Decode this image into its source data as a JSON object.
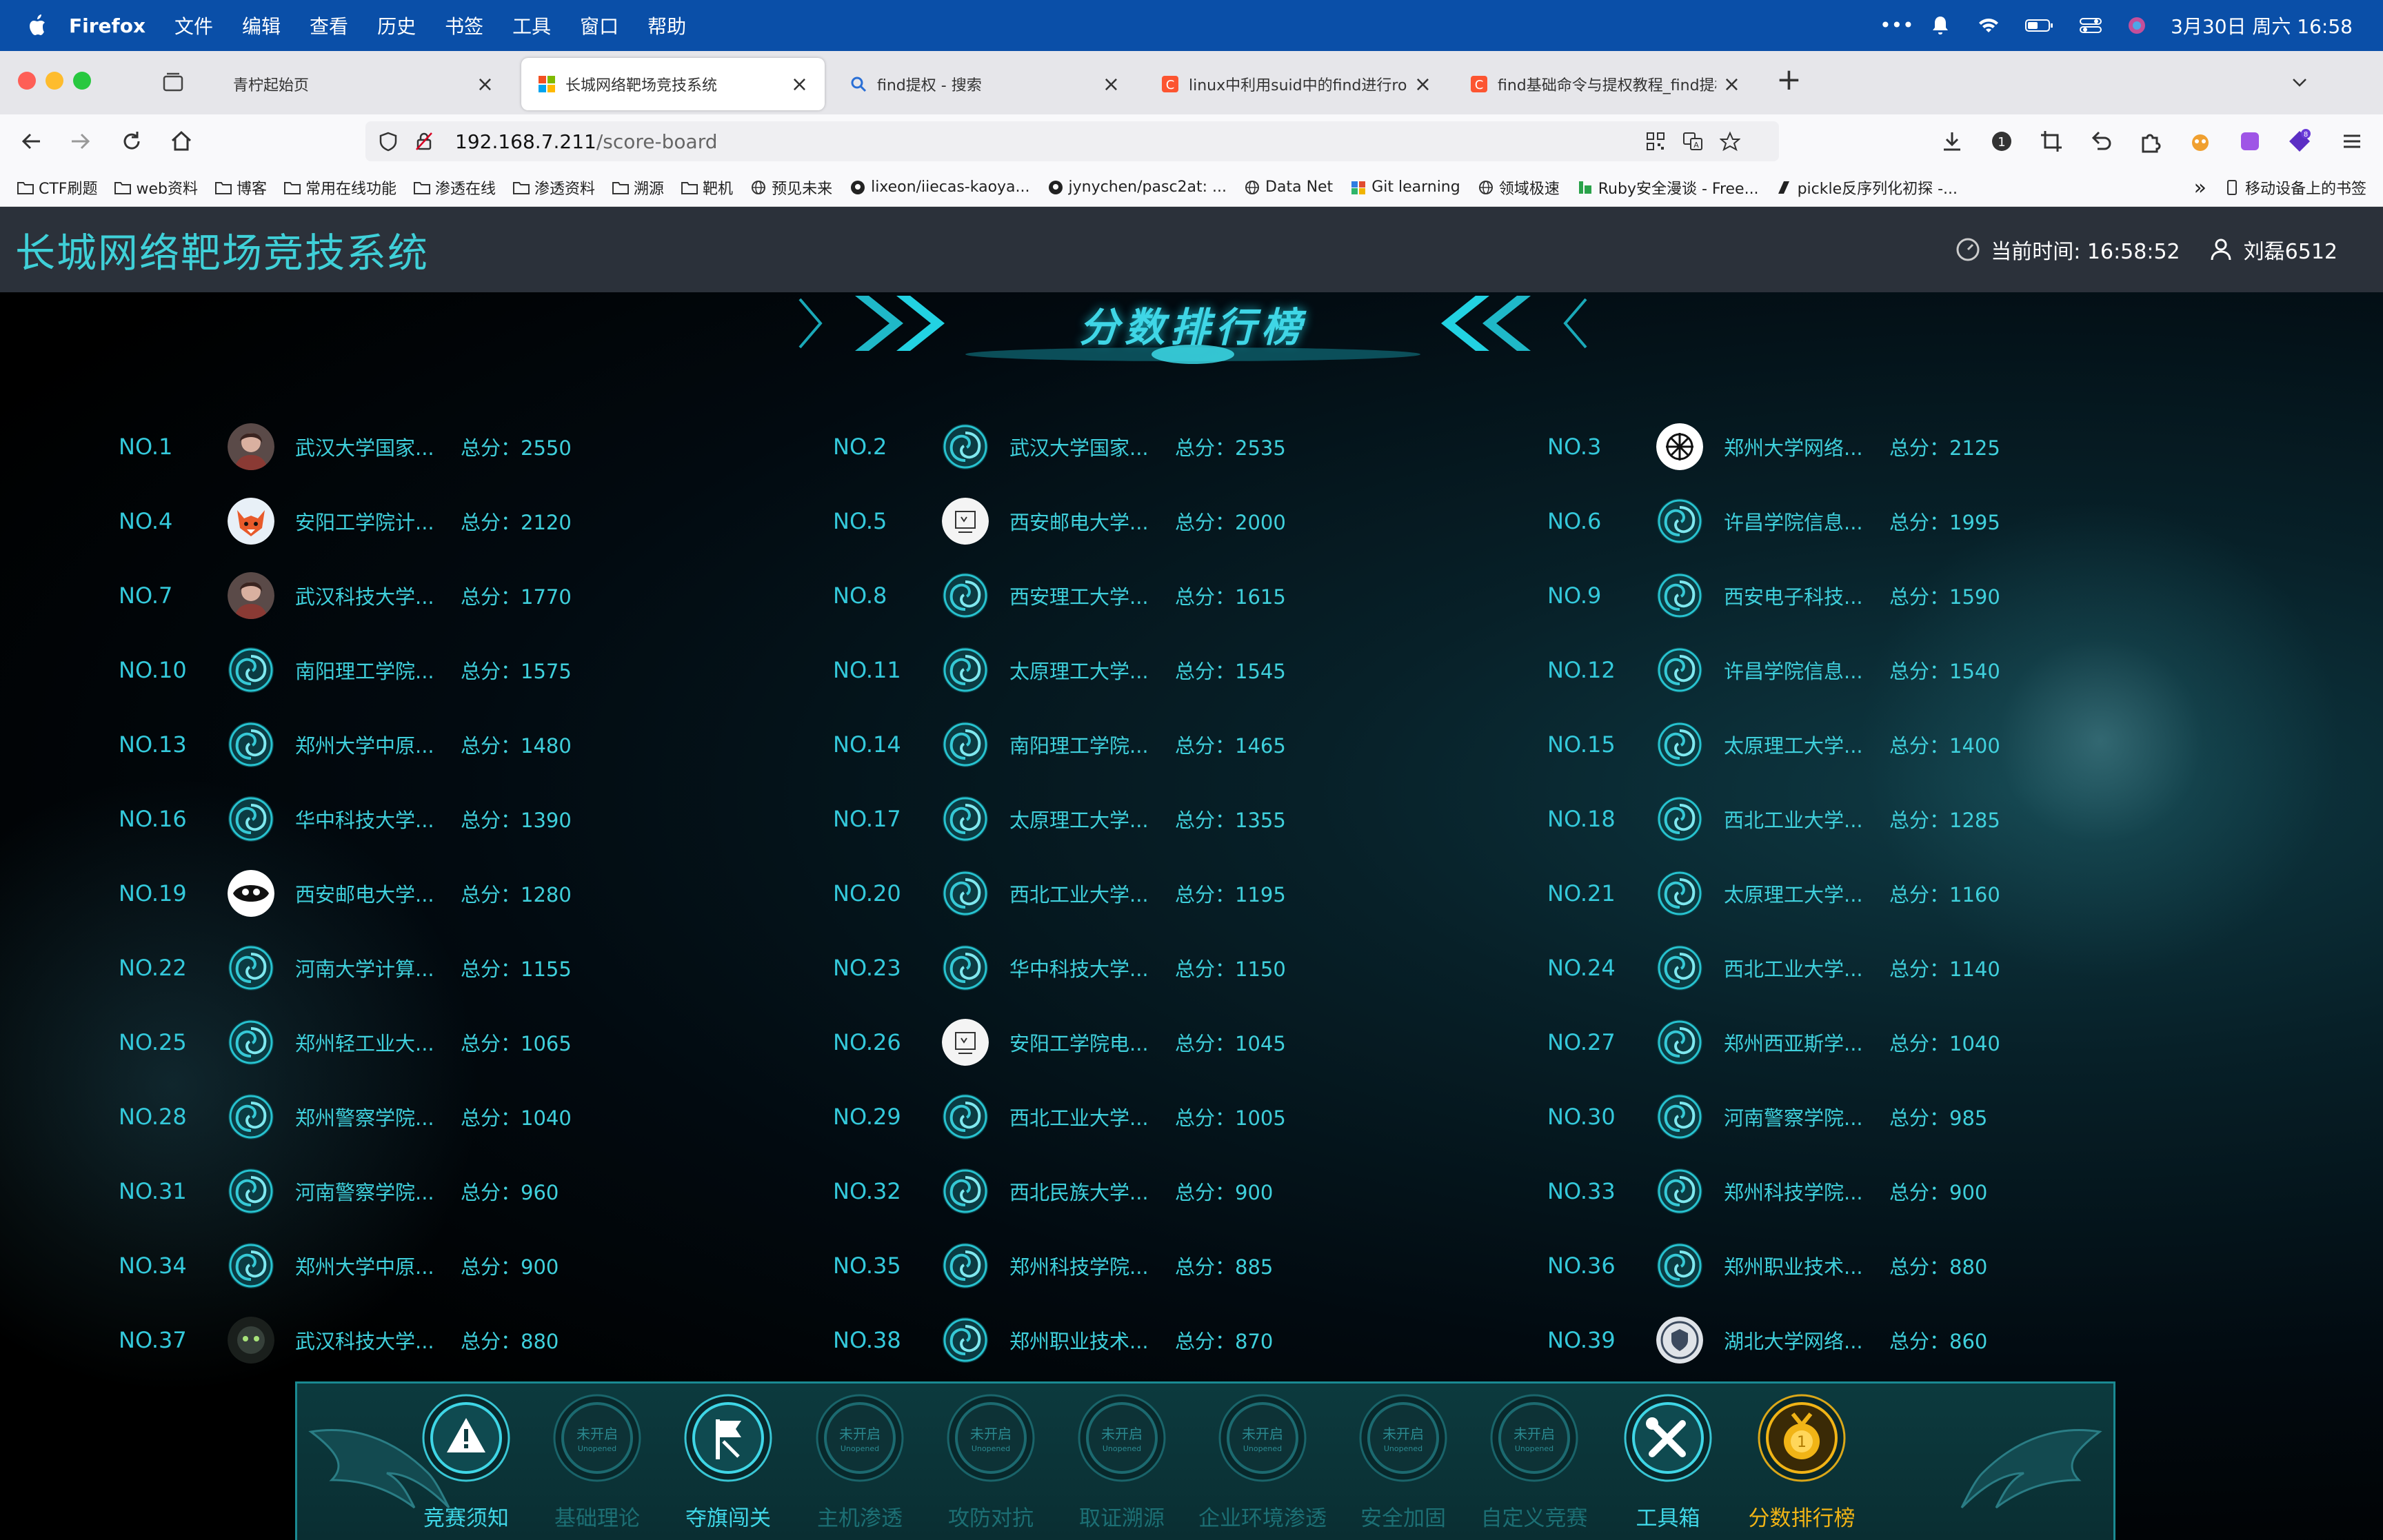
{
  "menubar": {
    "app": "Firefox",
    "menus": [
      "文件",
      "编辑",
      "查看",
      "历史",
      "书签",
      "工具",
      "窗口",
      "帮助"
    ],
    "clock": "3月30日 周六  16:58"
  },
  "tabs": [
    {
      "title": "青柠起始页",
      "active": false
    },
    {
      "title": "长城网络靶场竞技系统",
      "active": true
    },
    {
      "title": "find提权 - 搜索",
      "active": false
    },
    {
      "title": "linux中利用suid中的find进行root",
      "active": false
    },
    {
      "title": "find基础命令与提权教程_find提权",
      "active": false
    }
  ],
  "new_tab": "+",
  "url": {
    "host": "192.168.7.211",
    "path": "/score-board"
  },
  "bookmarks": [
    "CTF刷题",
    "web资料",
    "博客",
    "常用在线功能",
    "渗透在线",
    "渗透资料",
    "溯源",
    "靶机",
    "预见未来",
    "lixeon/iiecas-kaoya...",
    "jynychen/pasc2at: ...",
    "Data Net",
    "Git learning",
    "领域极速",
    "Ruby安全漫谈 - Free...",
    "pickle反序列化初探 -..."
  ],
  "bookmarks_more": "»",
  "mobile_bookmarks": "移动设备上的书签",
  "site": {
    "title": "长城网络靶场竞技系统",
    "time_label": "当前时间: 16:58:52",
    "user": "刘磊6512"
  },
  "board": {
    "title": "分数排行榜",
    "score_prefix": "总分：",
    "entries": [
      {
        "no": "NO.1",
        "name": "武汉大学国家...",
        "score": "2550",
        "avatar": "photo"
      },
      {
        "no": "NO.2",
        "name": "武汉大学国家...",
        "score": "2535",
        "avatar": "swirl"
      },
      {
        "no": "NO.3",
        "name": "郑州大学网络...",
        "score": "2125",
        "avatar": "knot"
      },
      {
        "no": "NO.4",
        "name": "安阳工学院计...",
        "score": "2120",
        "avatar": "fox"
      },
      {
        "no": "NO.5",
        "name": "西安邮电大学...",
        "score": "2000",
        "avatar": "sketch"
      },
      {
        "no": "NO.6",
        "name": "许昌学院信息...",
        "score": "1995",
        "avatar": "swirl"
      },
      {
        "no": "NO.7",
        "name": "武汉科技大学...",
        "score": "1770",
        "avatar": "photo"
      },
      {
        "no": "NO.8",
        "name": "西安理工大学...",
        "score": "1615",
        "avatar": "swirl"
      },
      {
        "no": "NO.9",
        "name": "西安电子科技...",
        "score": "1590",
        "avatar": "swirl"
      },
      {
        "no": "NO.10",
        "name": "南阳理工学院...",
        "score": "1575",
        "avatar": "swirl"
      },
      {
        "no": "NO.11",
        "name": "太原理工大学...",
        "score": "1545",
        "avatar": "swirl"
      },
      {
        "no": "NO.12",
        "name": "许昌学院信息...",
        "score": "1540",
        "avatar": "swirl"
      },
      {
        "no": "NO.13",
        "name": "郑州大学中原...",
        "score": "1480",
        "avatar": "swirl"
      },
      {
        "no": "NO.14",
        "name": "南阳理工学院...",
        "score": "1465",
        "avatar": "swirl"
      },
      {
        "no": "NO.15",
        "name": "太原理工大学...",
        "score": "1400",
        "avatar": "swirl"
      },
      {
        "no": "NO.16",
        "name": "华中科技大学...",
        "score": "1390",
        "avatar": "swirl"
      },
      {
        "no": "NO.17",
        "name": "太原理工大学...",
        "score": "1355",
        "avatar": "swirl"
      },
      {
        "no": "NO.18",
        "name": "西北工业大学...",
        "score": "1285",
        "avatar": "swirl"
      },
      {
        "no": "NO.19",
        "name": "西安邮电大学...",
        "score": "1280",
        "avatar": "bw"
      },
      {
        "no": "NO.20",
        "name": "西北工业大学...",
        "score": "1195",
        "avatar": "swirl"
      },
      {
        "no": "NO.21",
        "name": "太原理工大学...",
        "score": "1160",
        "avatar": "swirl"
      },
      {
        "no": "NO.22",
        "name": "河南大学计算...",
        "score": "1155",
        "avatar": "swirl"
      },
      {
        "no": "NO.23",
        "name": "华中科技大学...",
        "score": "1150",
        "avatar": "swirl"
      },
      {
        "no": "NO.24",
        "name": "西北工业大学...",
        "score": "1140",
        "avatar": "swirl"
      },
      {
        "no": "NO.25",
        "name": "郑州轻工业大...",
        "score": "1065",
        "avatar": "swirl"
      },
      {
        "no": "NO.26",
        "name": "安阳工学院电...",
        "score": "1045",
        "avatar": "sketch"
      },
      {
        "no": "NO.27",
        "name": "郑州西亚斯学...",
        "score": "1040",
        "avatar": "swirl"
      },
      {
        "no": "NO.28",
        "name": "郑州警察学院...",
        "score": "1040",
        "avatar": "swirl"
      },
      {
        "no": "NO.29",
        "name": "西北工业大学...",
        "score": "1005",
        "avatar": "swirl"
      },
      {
        "no": "NO.30",
        "name": "河南警察学院...",
        "score": "985",
        "avatar": "swirl"
      },
      {
        "no": "NO.31",
        "name": "河南警察学院...",
        "score": "960",
        "avatar": "swirl"
      },
      {
        "no": "NO.32",
        "name": "西北民族大学...",
        "score": "900",
        "avatar": "swirl"
      },
      {
        "no": "NO.33",
        "name": "郑州科技学院...",
        "score": "900",
        "avatar": "swirl"
      },
      {
        "no": "NO.34",
        "name": "郑州大学中原...",
        "score": "900",
        "avatar": "swirl"
      },
      {
        "no": "NO.35",
        "name": "郑州科技学院...",
        "score": "885",
        "avatar": "swirl"
      },
      {
        "no": "NO.36",
        "name": "郑州职业技术...",
        "score": "880",
        "avatar": "swirl"
      },
      {
        "no": "NO.37",
        "name": "武汉科技大学...",
        "score": "880",
        "avatar": "dark"
      },
      {
        "no": "NO.38",
        "name": "郑州职业技术...",
        "score": "870",
        "avatar": "swirl"
      },
      {
        "no": "NO.39",
        "name": "湖北大学网络...",
        "score": "860",
        "avatar": "badge"
      }
    ]
  },
  "dock": {
    "items": [
      {
        "label": "竞赛须知",
        "state": "on",
        "icon": "warning-icon"
      },
      {
        "label": "基础理论",
        "state": "off",
        "icon": "unopened-icon"
      },
      {
        "label": "夺旗闯关",
        "state": "on",
        "icon": "flag-icon"
      },
      {
        "label": "主机渗透",
        "state": "off",
        "icon": "unopened-icon"
      },
      {
        "label": "攻防对抗",
        "state": "off",
        "icon": "unopened-icon"
      },
      {
        "label": "取证溯源",
        "state": "off",
        "icon": "unopened-icon"
      },
      {
        "label": "企业环境渗透",
        "state": "off",
        "icon": "unopened-icon"
      },
      {
        "label": "安全加固",
        "state": "off",
        "icon": "unopened-icon"
      },
      {
        "label": "自定义竞赛",
        "state": "off",
        "icon": "unopened-icon"
      },
      {
        "label": "工具箱",
        "state": "on",
        "icon": "tools-icon"
      },
      {
        "label": "分数排行榜",
        "state": "active",
        "icon": "medal-icon"
      }
    ],
    "unopened_text": "未开启",
    "unopened_sub": "Unopened"
  },
  "colors": {
    "accent": "#3fd0dc",
    "active": "#f1b416",
    "header_bg": "#2b313a",
    "menubar_bg": "#0a4fa8"
  }
}
